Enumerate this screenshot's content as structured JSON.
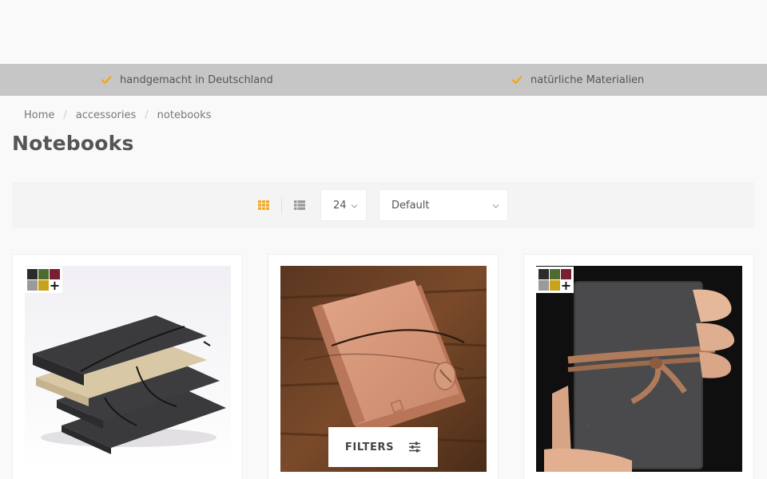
{
  "usp": {
    "item1": "handgemacht in Deutschland",
    "item2": "natürliche Materialien"
  },
  "breadcrumb": {
    "home": "Home",
    "sep": "/",
    "level1": "accessories",
    "level2": "notebooks"
  },
  "page": {
    "title": "Notebooks"
  },
  "toolbar": {
    "per_page": "24",
    "sort": "Default"
  },
  "filters": {
    "label": "FILTERS"
  },
  "colors": {
    "accent": "#f0a820",
    "swatch_charcoal": "#2b2b2b",
    "swatch_olive": "#4d6b2e",
    "swatch_bordeaux": "#7a1f33",
    "swatch_gray": "#9a9a9a",
    "swatch_mustard": "#c9a21a"
  },
  "icons": {
    "usp": "check-icon",
    "grid_view": "grid-icon",
    "list_view": "list-icon",
    "select": "chevron-down-icon",
    "filters": "sliders-icon"
  },
  "swatch_more": "+"
}
